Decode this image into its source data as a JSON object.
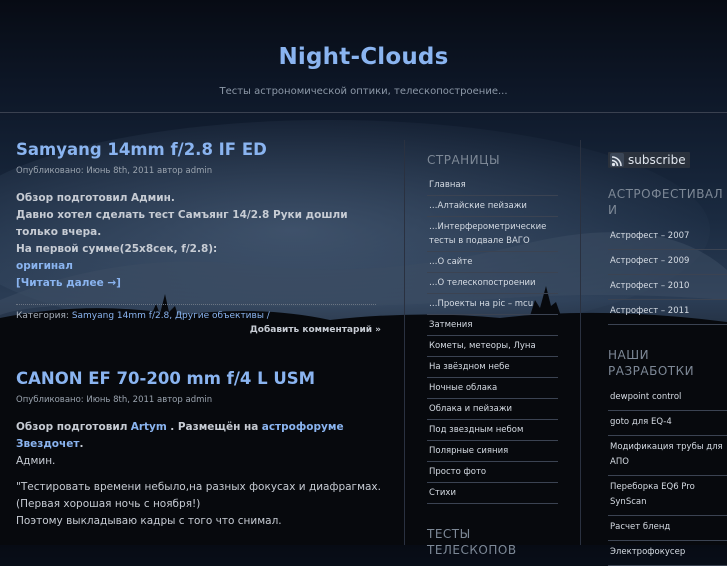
{
  "site": {
    "title": "Night-Clouds",
    "description": "Тесты астрономической оптики, телескопостроение..."
  },
  "posts": [
    {
      "title": "Samyang 14mm f/2.8 IF ED",
      "meta_prefix": "Опубликовано: Июнь 8th, 2011 автор",
      "author": "admin",
      "line1": "Обзор подготовил Админ.",
      "line2": "Давно хотел сделать тест Самъянг 14/2.8 Руки дошли только вчера.",
      "line3": "На первой сумме(25х8сек, f/2.8):",
      "link1": "оригинал",
      "read_more": "[Читать далее →]",
      "category_label": "Категория:",
      "categories": "Samyang 14mm f/2.8, Другие объективы /",
      "add_comment": "Добавить комментарий »"
    },
    {
      "title": "CANON EF 70-200 mm f/4 L USM",
      "meta_prefix": "Опубликовано: Июнь 8th, 2011 автор",
      "author": "admin",
      "intro_a": "Обзор подготовил",
      "intro_link": "Artym",
      "intro_b": ". Размещён на",
      "intro_link2": "астрофоруме Звездочет",
      "intro_c": ".",
      "intro_admin": "Админ.",
      "quote1": "\"Тестировать времени небыло,на разных фокусах и диафрагмах.(Первая хорошая ночь с ноября!)",
      "quote2": "Поэтому выкладываю кадры с того что снимал."
    }
  ],
  "sidebar_pages": {
    "heading": "СТРАНИЦЫ",
    "items": [
      "Главная",
      "…Алтайские пейзажи",
      "…Интерферометрические тесты в подвале ВАГО",
      "…О сайте",
      "…О телескопостроении",
      "…Проекты на pic – mcu",
      "Затмения",
      "Кометы, метеоры, Луна",
      "На звёздном небе",
      "Ночные облака",
      "Облака и пейзажи",
      "Под звездным небом",
      "Полярные сияния",
      "Просто фото",
      "Стихи"
    ],
    "next_heading": "ТЕСТЫ ТЕЛЕСКОПОВ"
  },
  "sidebar_right": {
    "subscribe": "subscribe",
    "fest_heading": "АСТРОФЕСТИВАЛИ",
    "fest_items": [
      "Астрофест – 2007",
      "Астрофест – 2009",
      "Астрофест – 2010",
      "Астрофест – 2011"
    ],
    "dev_heading": "НАШИ РАЗРАБОТКИ",
    "dev_items": [
      "dewpoint control",
      "goto для EQ-4",
      "Модификация трубы для АПО",
      "Переборка EQ6 Pro SynScan",
      "Расчет бленд",
      "Электрофокусер"
    ]
  },
  "colors": {
    "accent": "#8ab4f0",
    "text": "#c7ccd4",
    "muted": "#9aa3ae"
  }
}
